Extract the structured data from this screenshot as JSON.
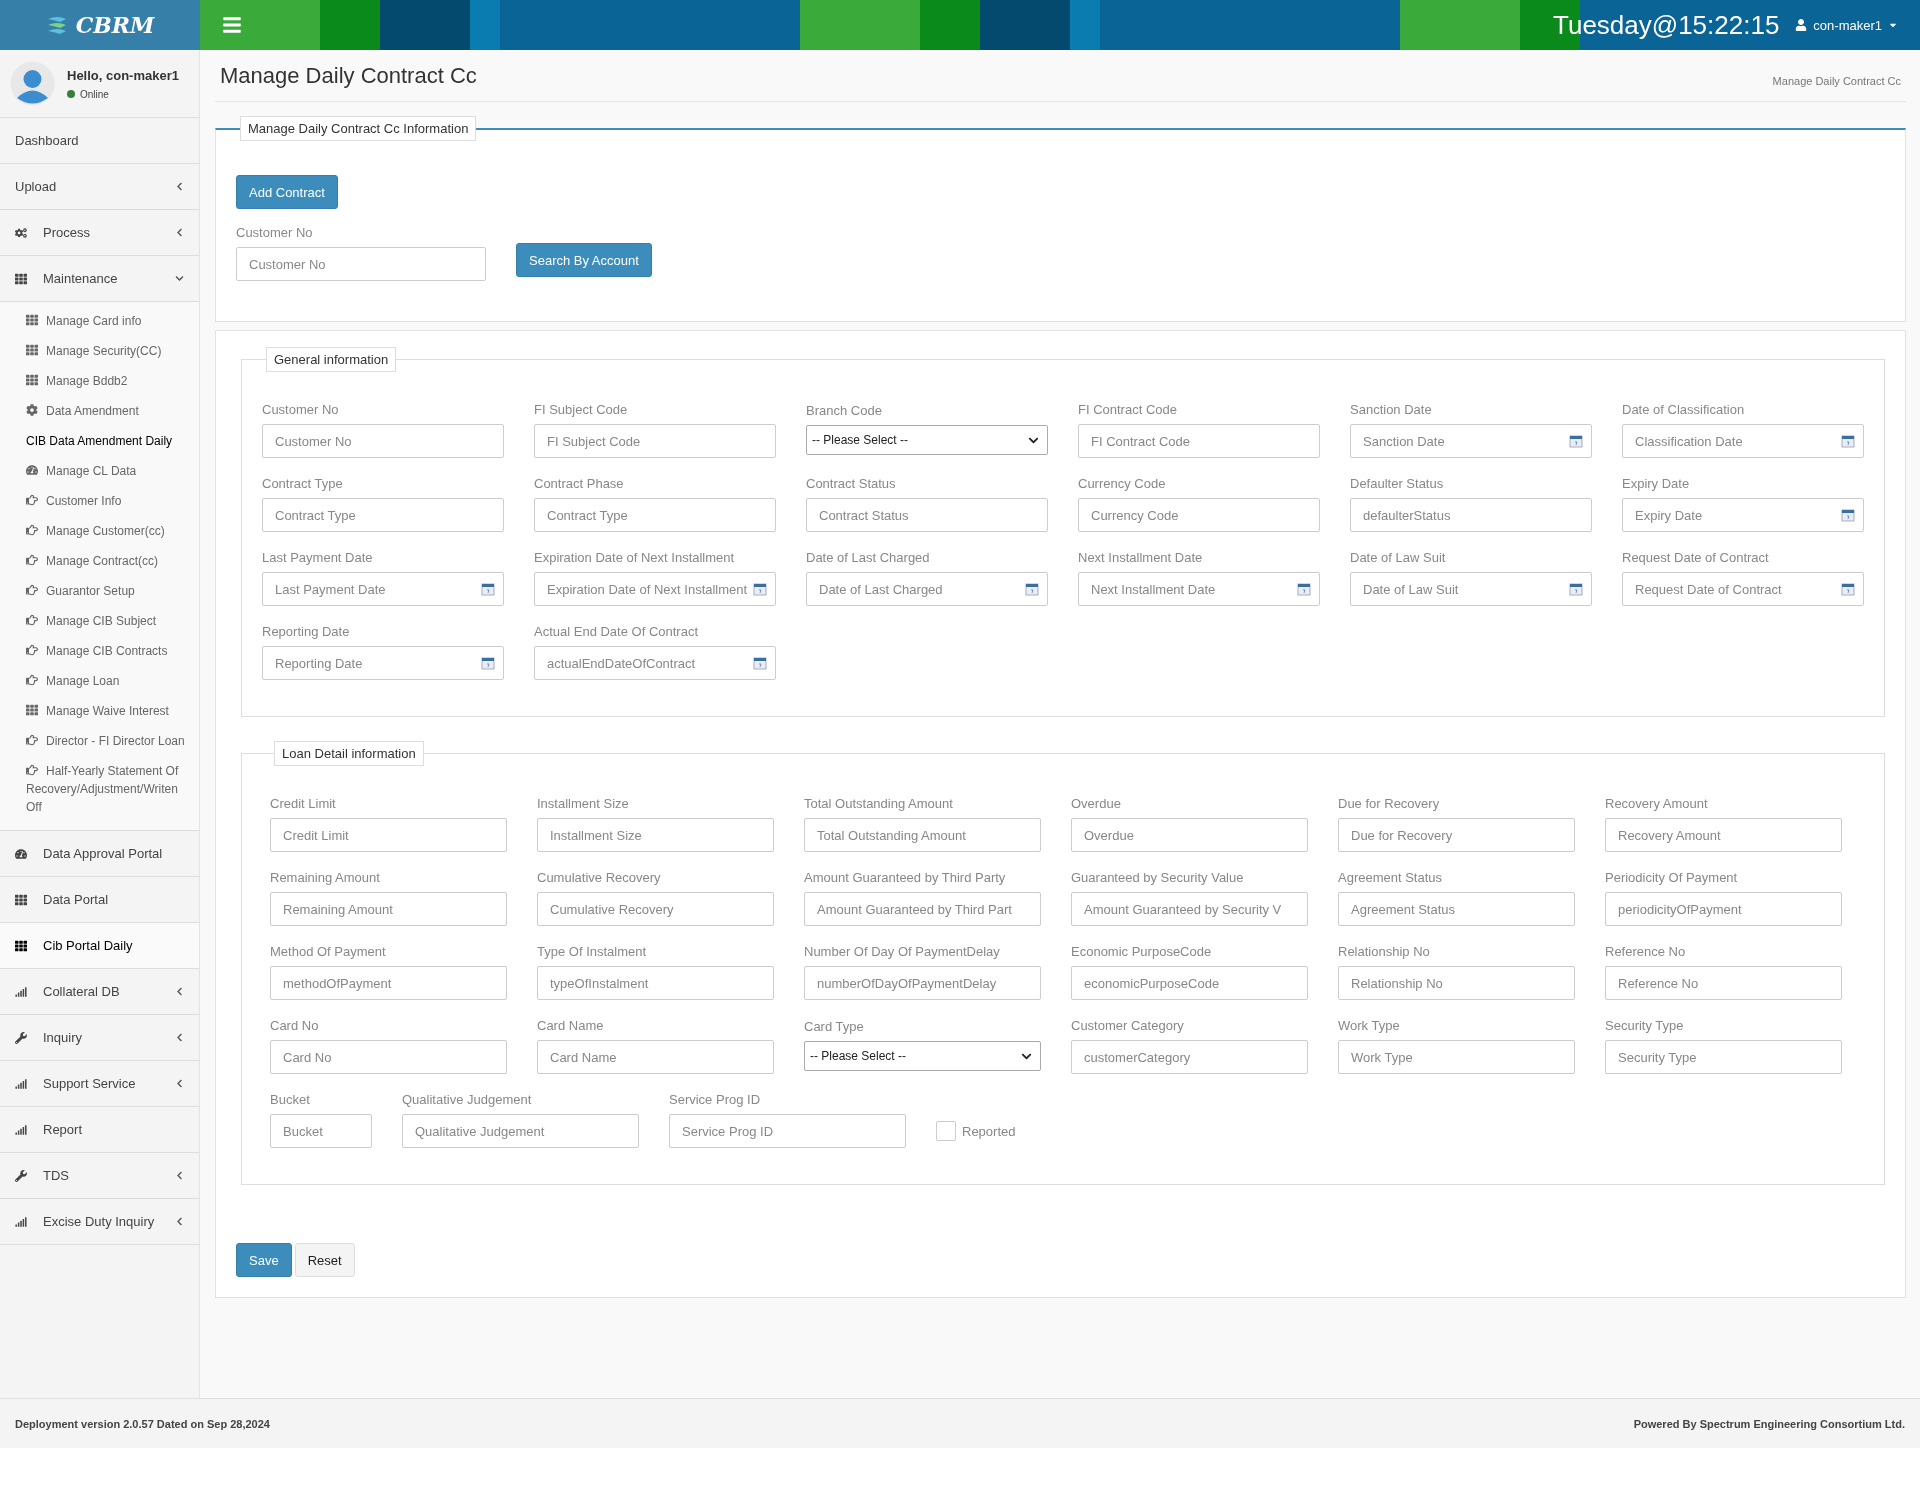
{
  "header": {
    "logo": "CBRM",
    "clock": "Tuesday@15:22:15",
    "user": "con-maker1"
  },
  "sidebar": {
    "greeting": "Hello, con-maker1",
    "status": "Online",
    "items": [
      {
        "label": "Dashboard",
        "kind": "none",
        "selected": false
      },
      {
        "label": "Upload",
        "kind": "none",
        "selected": false,
        "expanded": false
      },
      {
        "label": "Process",
        "kind": "gears",
        "selected": false,
        "expanded": false
      },
      {
        "label": "Maintenance",
        "kind": "grid",
        "selected": false,
        "expanded": true,
        "children": [
          {
            "label": "Manage Card info",
            "kind": "grid",
            "selected": false
          },
          {
            "label": "Manage Security(CC)",
            "kind": "grid",
            "selected": false
          },
          {
            "label": "Manage Bddb2",
            "kind": "grid",
            "selected": false
          },
          {
            "label": "Data Amendment",
            "kind": "gear",
            "selected": false
          },
          {
            "label": "CIB Data Amendment Daily",
            "kind": "none",
            "selected": true
          },
          {
            "label": "Manage CL Data",
            "kind": "gauge",
            "selected": false
          },
          {
            "label": "Customer Info",
            "kind": "hand",
            "selected": false
          },
          {
            "label": "Manage Customer(cc)",
            "kind": "hand",
            "selected": false
          },
          {
            "label": "Manage Contract(cc)",
            "kind": "hand",
            "selected": false
          },
          {
            "label": "Guarantor Setup",
            "kind": "hand",
            "selected": false
          },
          {
            "label": "Manage CIB Subject",
            "kind": "hand",
            "selected": false
          },
          {
            "label": "Manage CIB Contracts",
            "kind": "hand",
            "selected": false
          },
          {
            "label": "Manage Loan",
            "kind": "hand",
            "selected": false
          },
          {
            "label": "Manage Waive Interest",
            "kind": "grid",
            "selected": false
          },
          {
            "label": "Director - FI Director Loan",
            "kind": "hand",
            "selected": false
          },
          {
            "label": "Half-Yearly Statement Of Recovery/Adjustment/Writen Off",
            "kind": "hand",
            "selected": false
          }
        ]
      },
      {
        "label": "Data Approval Portal",
        "kind": "gauge",
        "selected": false
      },
      {
        "label": "Data Portal",
        "kind": "grid",
        "selected": false
      },
      {
        "label": "Cib Portal Daily",
        "kind": "grid",
        "selected": true
      },
      {
        "label": "Collateral DB",
        "kind": "bars",
        "selected": false,
        "expanded": false
      },
      {
        "label": "Inquiry",
        "kind": "wrench",
        "selected": false,
        "expanded": false
      },
      {
        "label": "Support Service",
        "kind": "bars",
        "selected": false,
        "expanded": false
      },
      {
        "label": "Report",
        "kind": "bars",
        "selected": false
      },
      {
        "label": "TDS",
        "kind": "wrench",
        "selected": false,
        "expanded": false
      },
      {
        "label": "Excise Duty Inquiry",
        "kind": "bars",
        "selected": false,
        "expanded": false
      }
    ]
  },
  "page": {
    "title": "Manage Daily Contract Cc",
    "breadcrumb": "Manage Daily Contract Cc"
  },
  "search_panel": {
    "legend": "Manage Daily Contract Cc Information",
    "add_button": "Add Contract",
    "label": "Customer No",
    "placeholder": "Customer No",
    "search_button": "Search By Account"
  },
  "sections": [
    {
      "legend": "General information",
      "rows": [
        [
          {
            "label": "Customer No",
            "placeholder": "Customer No",
            "kind": "text"
          },
          {
            "label": "FI Subject Code",
            "placeholder": "FI Subject Code",
            "kind": "text"
          },
          {
            "label": "Branch Code",
            "value": "-- Please Select --",
            "kind": "select"
          },
          {
            "label": "FI Contract Code",
            "placeholder": "FI Contract Code",
            "kind": "text"
          },
          {
            "label": "Sanction Date",
            "placeholder": "Sanction Date",
            "kind": "date"
          },
          {
            "label": "Date of Classification",
            "placeholder": "Classification Date",
            "kind": "date"
          }
        ],
        [
          {
            "label": "Contract Type",
            "placeholder": "Contract Type",
            "kind": "text"
          },
          {
            "label": "Contract Phase",
            "placeholder": "Contract Type",
            "kind": "text"
          },
          {
            "label": "Contract Status",
            "placeholder": "Contract Status",
            "kind": "text"
          },
          {
            "label": "Currency Code",
            "placeholder": "Currency Code",
            "kind": "text"
          },
          {
            "label": "Defaulter Status",
            "placeholder": "defaulterStatus",
            "kind": "text"
          },
          {
            "label": "Expiry Date",
            "placeholder": "Expiry Date",
            "kind": "date"
          }
        ],
        [
          {
            "label": "Last Payment Date",
            "placeholder": "Last Payment Date",
            "kind": "date"
          },
          {
            "label": "Expiration Date of Next Installment",
            "placeholder": "Expiration Date of Next Installment",
            "kind": "date"
          },
          {
            "label": "Date of Last Charged",
            "placeholder": "Date of Last Charged",
            "kind": "date"
          },
          {
            "label": "Next Installment Date",
            "placeholder": "Next Installment Date",
            "kind": "date"
          },
          {
            "label": "Date of Law Suit",
            "placeholder": "Date of Law Suit",
            "kind": "date"
          },
          {
            "label": "Request Date of Contract",
            "placeholder": "Request Date of Contract",
            "kind": "date"
          }
        ],
        [
          {
            "label": "Reporting Date",
            "placeholder": "Reporting Date",
            "kind": "date"
          },
          {
            "label": "Actual End Date Of Contract",
            "placeholder": "actualEndDateOfContract",
            "kind": "date"
          }
        ]
      ]
    },
    {
      "legend": "Loan Detail information",
      "rows": [
        [
          {
            "label": "Credit Limit",
            "placeholder": "Credit Limit",
            "kind": "text"
          },
          {
            "label": "Installment Size",
            "placeholder": "Installment Size",
            "kind": "text"
          },
          {
            "label": "Total Outstanding Amount",
            "placeholder": "Total Outstanding Amount",
            "kind": "text"
          },
          {
            "label": "Overdue",
            "placeholder": "Overdue",
            "kind": "text"
          },
          {
            "label": "Due for Recovery",
            "placeholder": "Due for Recovery",
            "kind": "text"
          },
          {
            "label": "Recovery Amount",
            "placeholder": "Recovery Amount",
            "kind": "text"
          }
        ],
        [
          {
            "label": "Remaining Amount",
            "placeholder": "Remaining Amount",
            "kind": "text"
          },
          {
            "label": "Cumulative Recovery",
            "placeholder": "Cumulative Recovery",
            "kind": "text"
          },
          {
            "label": "Amount Guaranteed by Third Party",
            "placeholder": "Amount Guaranteed by Third Part",
            "kind": "text"
          },
          {
            "label": "Guaranteed by Security Value",
            "placeholder": "Amount Guaranteed by Security V",
            "kind": "text"
          },
          {
            "label": "Agreement Status",
            "placeholder": "Agreement Status",
            "kind": "text"
          },
          {
            "label": "Periodicity Of Payment",
            "placeholder": "periodicityOfPayment",
            "kind": "text"
          }
        ],
        [
          {
            "label": "Method Of Payment",
            "placeholder": "methodOfPayment",
            "kind": "text"
          },
          {
            "label": "Type Of Instalment",
            "placeholder": "typeOfInstalment",
            "kind": "text"
          },
          {
            "label": "Number Of Day Of PaymentDelay",
            "placeholder": "numberOfDayOfPaymentDelay",
            "kind": "text"
          },
          {
            "label": "Economic PurposeCode",
            "placeholder": "economicPurposeCode",
            "kind": "text"
          },
          {
            "label": "Relationship No",
            "placeholder": "Relationship No",
            "kind": "text"
          },
          {
            "label": "Reference No",
            "placeholder": "Reference No",
            "kind": "text"
          }
        ],
        [
          {
            "label": "Card No",
            "placeholder": "Card No",
            "kind": "text"
          },
          {
            "label": "Card Name",
            "placeholder": "Card Name",
            "kind": "text"
          },
          {
            "label": "Card Type",
            "value": "-- Please Select --",
            "kind": "select"
          },
          {
            "label": "Customer Category",
            "placeholder": "customerCategory",
            "kind": "text"
          },
          {
            "label": "Work Type",
            "placeholder": "Work Type",
            "kind": "text"
          },
          {
            "label": "Security Type",
            "placeholder": "Security Type",
            "kind": "text"
          }
        ],
        [
          {
            "label": "Bucket",
            "placeholder": "Bucket",
            "kind": "short"
          },
          {
            "label": "Qualitative Judgement",
            "placeholder": "Qualitative Judgement",
            "kind": "text"
          },
          {
            "label": "Service Prog ID",
            "placeholder": "Service Prog ID",
            "kind": "text"
          },
          {
            "label": "Reported",
            "kind": "checkbox",
            "checked": false
          }
        ]
      ]
    }
  ],
  "actions": {
    "save": "Save",
    "reset": "Reset"
  },
  "footer": {
    "left": "Deployment version 2.0.57 Dated on Sep 28,2024",
    "right": "Powered By Spectrum Engineering Consortium Ltd."
  }
}
